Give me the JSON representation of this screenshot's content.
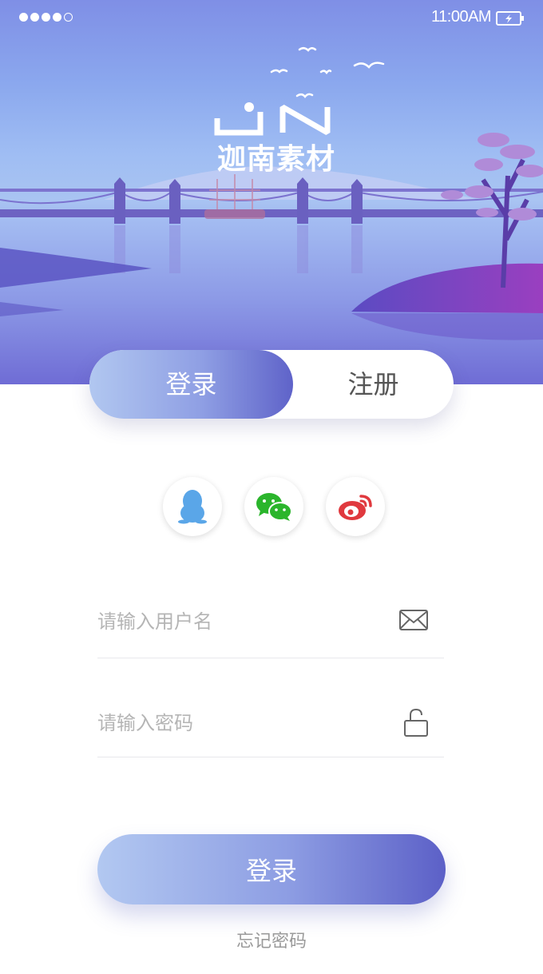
{
  "status_bar": {
    "time": "11:00AM",
    "signal_filled": 4,
    "signal_total": 5
  },
  "brand": {
    "name": "迦南素材"
  },
  "tabs": [
    {
      "label": "登录",
      "active": true
    },
    {
      "label": "注册",
      "active": false
    }
  ],
  "social": [
    {
      "name": "qq",
      "icon": "qq-penguin-icon",
      "color": "#5aa6e8"
    },
    {
      "name": "wechat",
      "icon": "wechat-icon",
      "color": "#2bb52c"
    },
    {
      "name": "weibo",
      "icon": "weibo-icon",
      "color": "#e0393e"
    }
  ],
  "form": {
    "username_placeholder": "请输入用户名",
    "username_value": "",
    "password_placeholder": "请输入密码",
    "password_value": "",
    "submit_label": "登录",
    "forgot_label": "忘记密码"
  },
  "colors": {
    "accent_start": "#b2c8f1",
    "accent_end": "#5c60c7"
  }
}
